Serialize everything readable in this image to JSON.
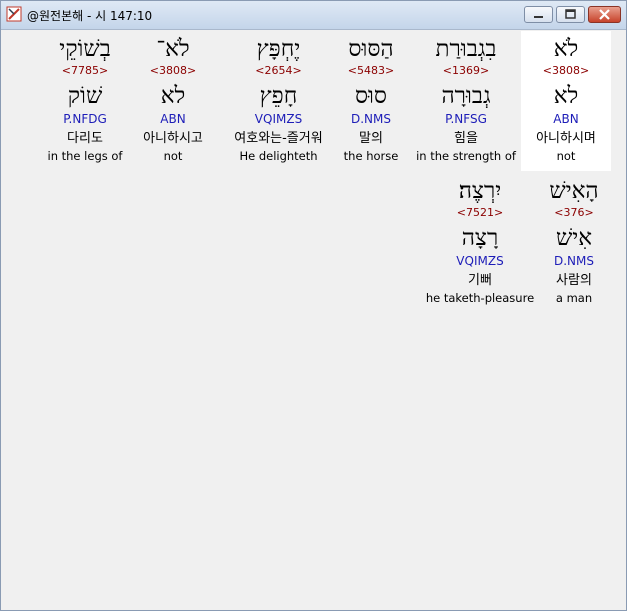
{
  "window": {
    "title": "@원전본해 - 시 147:10",
    "colors": {
      "strong": "#8b0000",
      "morph": "#1d1db8",
      "selected": "#ffffff"
    }
  },
  "row1": [
    {
      "word": "לֹא",
      "strong": "<3808>",
      "root": "לא",
      "morph": "ABN",
      "korean": "아니하시며",
      "english": "not"
    },
    {
      "word": "בִגְבוּרַת",
      "strong": "<1369>",
      "root": "גְבוּרָה",
      "morph": "P.NFSG",
      "korean": "힘을",
      "english": "in the strength of"
    },
    {
      "word": "הַסּוּס",
      "strong": "<5483>",
      "root": "סוּס",
      "morph": "D.NMS",
      "korean": "말의",
      "english": "the horse"
    },
    {
      "word": "יֶחְפָּץ",
      "strong": "<2654>",
      "root": "חָפֵץ",
      "morph": "VQIMZS",
      "korean": "여호와는-즐거워",
      "english": "He delighteth"
    },
    {
      "word": "לֹא־",
      "strong": "<3808>",
      "root": "לא",
      "morph": "ABN",
      "korean": "아니하시고",
      "english": "not"
    },
    {
      "word": "בְשׁוֹקֵי",
      "strong": "<7785>",
      "root": "שׁוֹק",
      "morph": "P.NFDG",
      "korean": "다리도",
      "english": "in the legs of"
    }
  ],
  "row2": [
    {
      "word": "הָאִישׁ",
      "strong": "<376>",
      "root": "אִישׁ",
      "morph": "D.NMS",
      "korean": "사람의",
      "english": "a man"
    },
    {
      "word": "יִרְצֶה׃",
      "strong": "<7521>",
      "root": "רָצָה",
      "morph": "VQIMZS",
      "korean": "기뻐",
      "english": "he taketh-pleasure"
    }
  ]
}
